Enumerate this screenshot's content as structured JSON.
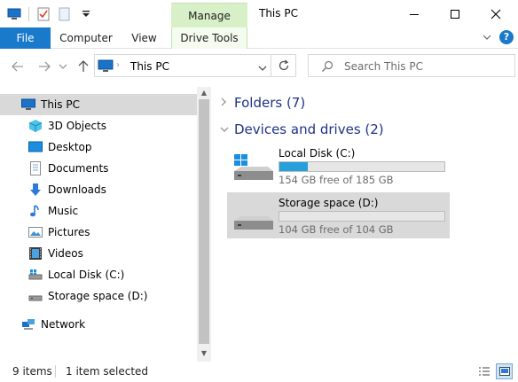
{
  "window": {
    "title": "This PC",
    "contextual_tab": "Manage",
    "minimize_icon": "minimize-icon",
    "maximize_icon": "maximize-icon",
    "close_icon": "close-icon"
  },
  "ribbon": {
    "tabs": [
      {
        "label": "File",
        "active": true
      },
      {
        "label": "Computer"
      },
      {
        "label": "View"
      },
      {
        "label": "Drive Tools"
      }
    ]
  },
  "address": {
    "location": "This PC",
    "search_placeholder": "Search This PC"
  },
  "nav": {
    "items": [
      {
        "label": "This PC",
        "icon": "pc-icon",
        "selected": true
      },
      {
        "label": "3D Objects",
        "icon": "3d-objects-icon"
      },
      {
        "label": "Desktop",
        "icon": "desktop-icon"
      },
      {
        "label": "Documents",
        "icon": "documents-icon"
      },
      {
        "label": "Downloads",
        "icon": "downloads-icon"
      },
      {
        "label": "Music",
        "icon": "music-icon"
      },
      {
        "label": "Pictures",
        "icon": "pictures-icon"
      },
      {
        "label": "Videos",
        "icon": "videos-icon"
      },
      {
        "label": "Local Disk (C:)",
        "icon": "local-disk-icon"
      },
      {
        "label": "Storage space (D:)",
        "icon": "storage-drive-icon"
      },
      {
        "label": "Network",
        "icon": "network-icon"
      }
    ]
  },
  "content": {
    "folders_header": "Folders (7)",
    "devices_header": "Devices and drives (2)",
    "drives": [
      {
        "name": "Local Disk (C:)",
        "free": "154 GB free of 185 GB",
        "used_fraction": 0.17,
        "selected": false
      },
      {
        "name": "Storage space (D:)",
        "free": "104 GB free of 104 GB",
        "used_fraction": 0.0,
        "selected": true
      }
    ]
  },
  "status": {
    "items_count": "9 items",
    "selection": "1 item selected"
  },
  "colors": {
    "accent": "#1979ca",
    "manage_tab": "#d8f0c8",
    "progress_fill": "#26a0da",
    "header_text": "#1e3287",
    "selection": "#d9d9d9"
  }
}
